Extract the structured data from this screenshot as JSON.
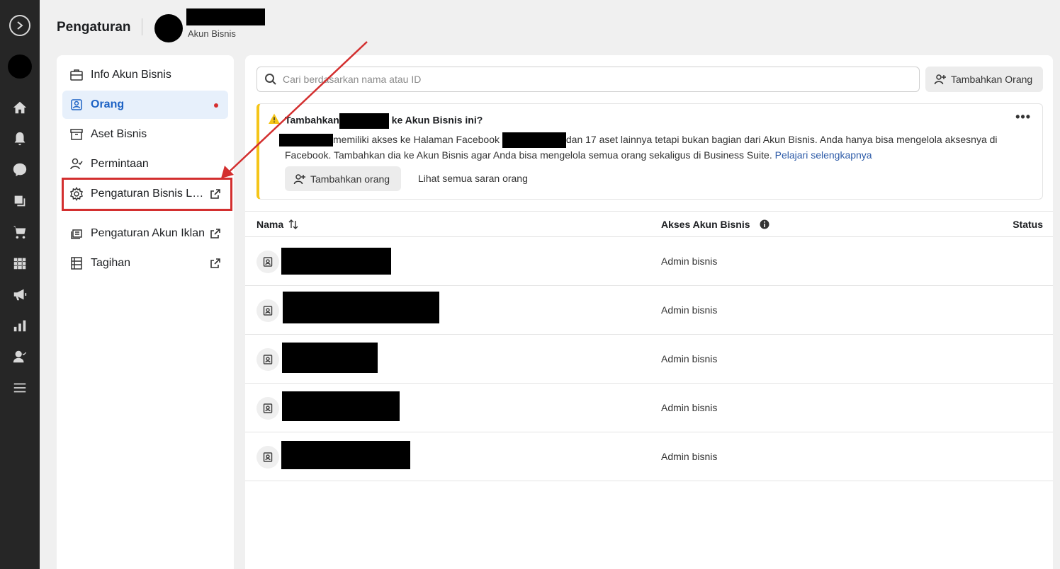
{
  "header": {
    "title": "Pengaturan",
    "account_type": "Akun Bisnis"
  },
  "sidebar": {
    "items": [
      {
        "label": "Info Akun Bisnis",
        "icon": "briefcase-icon"
      },
      {
        "label": "Orang",
        "icon": "people-icon",
        "active": true
      },
      {
        "label": "Aset Bisnis",
        "icon": "archive-icon"
      },
      {
        "label": "Permintaan",
        "icon": "person-check-icon"
      },
      {
        "label": "Pengaturan Bisnis Lanjutan",
        "icon": "gear-icon",
        "external": true
      },
      {
        "label": "Pengaturan Akun Iklan",
        "icon": "ads-icon",
        "external": true
      },
      {
        "label": "Tagihan",
        "icon": "billing-icon",
        "external": true
      }
    ]
  },
  "main": {
    "search_placeholder": "Cari berdasarkan nama atau ID",
    "add_button": "Tambahkan Orang",
    "banner": {
      "title_prefix": "Tambahkan",
      "title_suffix": "ke Akun Bisnis ini?",
      "text_part1": "memiliki akses ke Halaman Facebook",
      "text_part2": "dan 17 aset lainnya tetapi bukan bagian dari Akun Bisnis. Anda hanya bisa mengelola aksesnya di Facebook. Tambahkan dia ke Akun Bisnis agar Anda bisa mengelola semua orang sekaligus di Business Suite.",
      "link": "Pelajari selengkapnya",
      "button": "Tambahkan orang",
      "secondary_link": "Lihat semua saran orang"
    },
    "table": {
      "columns": [
        "Nama",
        "Akses Akun Bisnis",
        "Status"
      ],
      "rows": [
        {
          "access": "Admin bisnis"
        },
        {
          "access": "Admin bisnis"
        },
        {
          "access": "Admin bisnis"
        },
        {
          "access": "Admin bisnis"
        },
        {
          "access": "Admin bisnis"
        }
      ]
    }
  },
  "colors": {
    "accent": "#1d62c4",
    "highlight": "#d32f2f",
    "warning": "#f5c518",
    "rail": "#262626"
  }
}
